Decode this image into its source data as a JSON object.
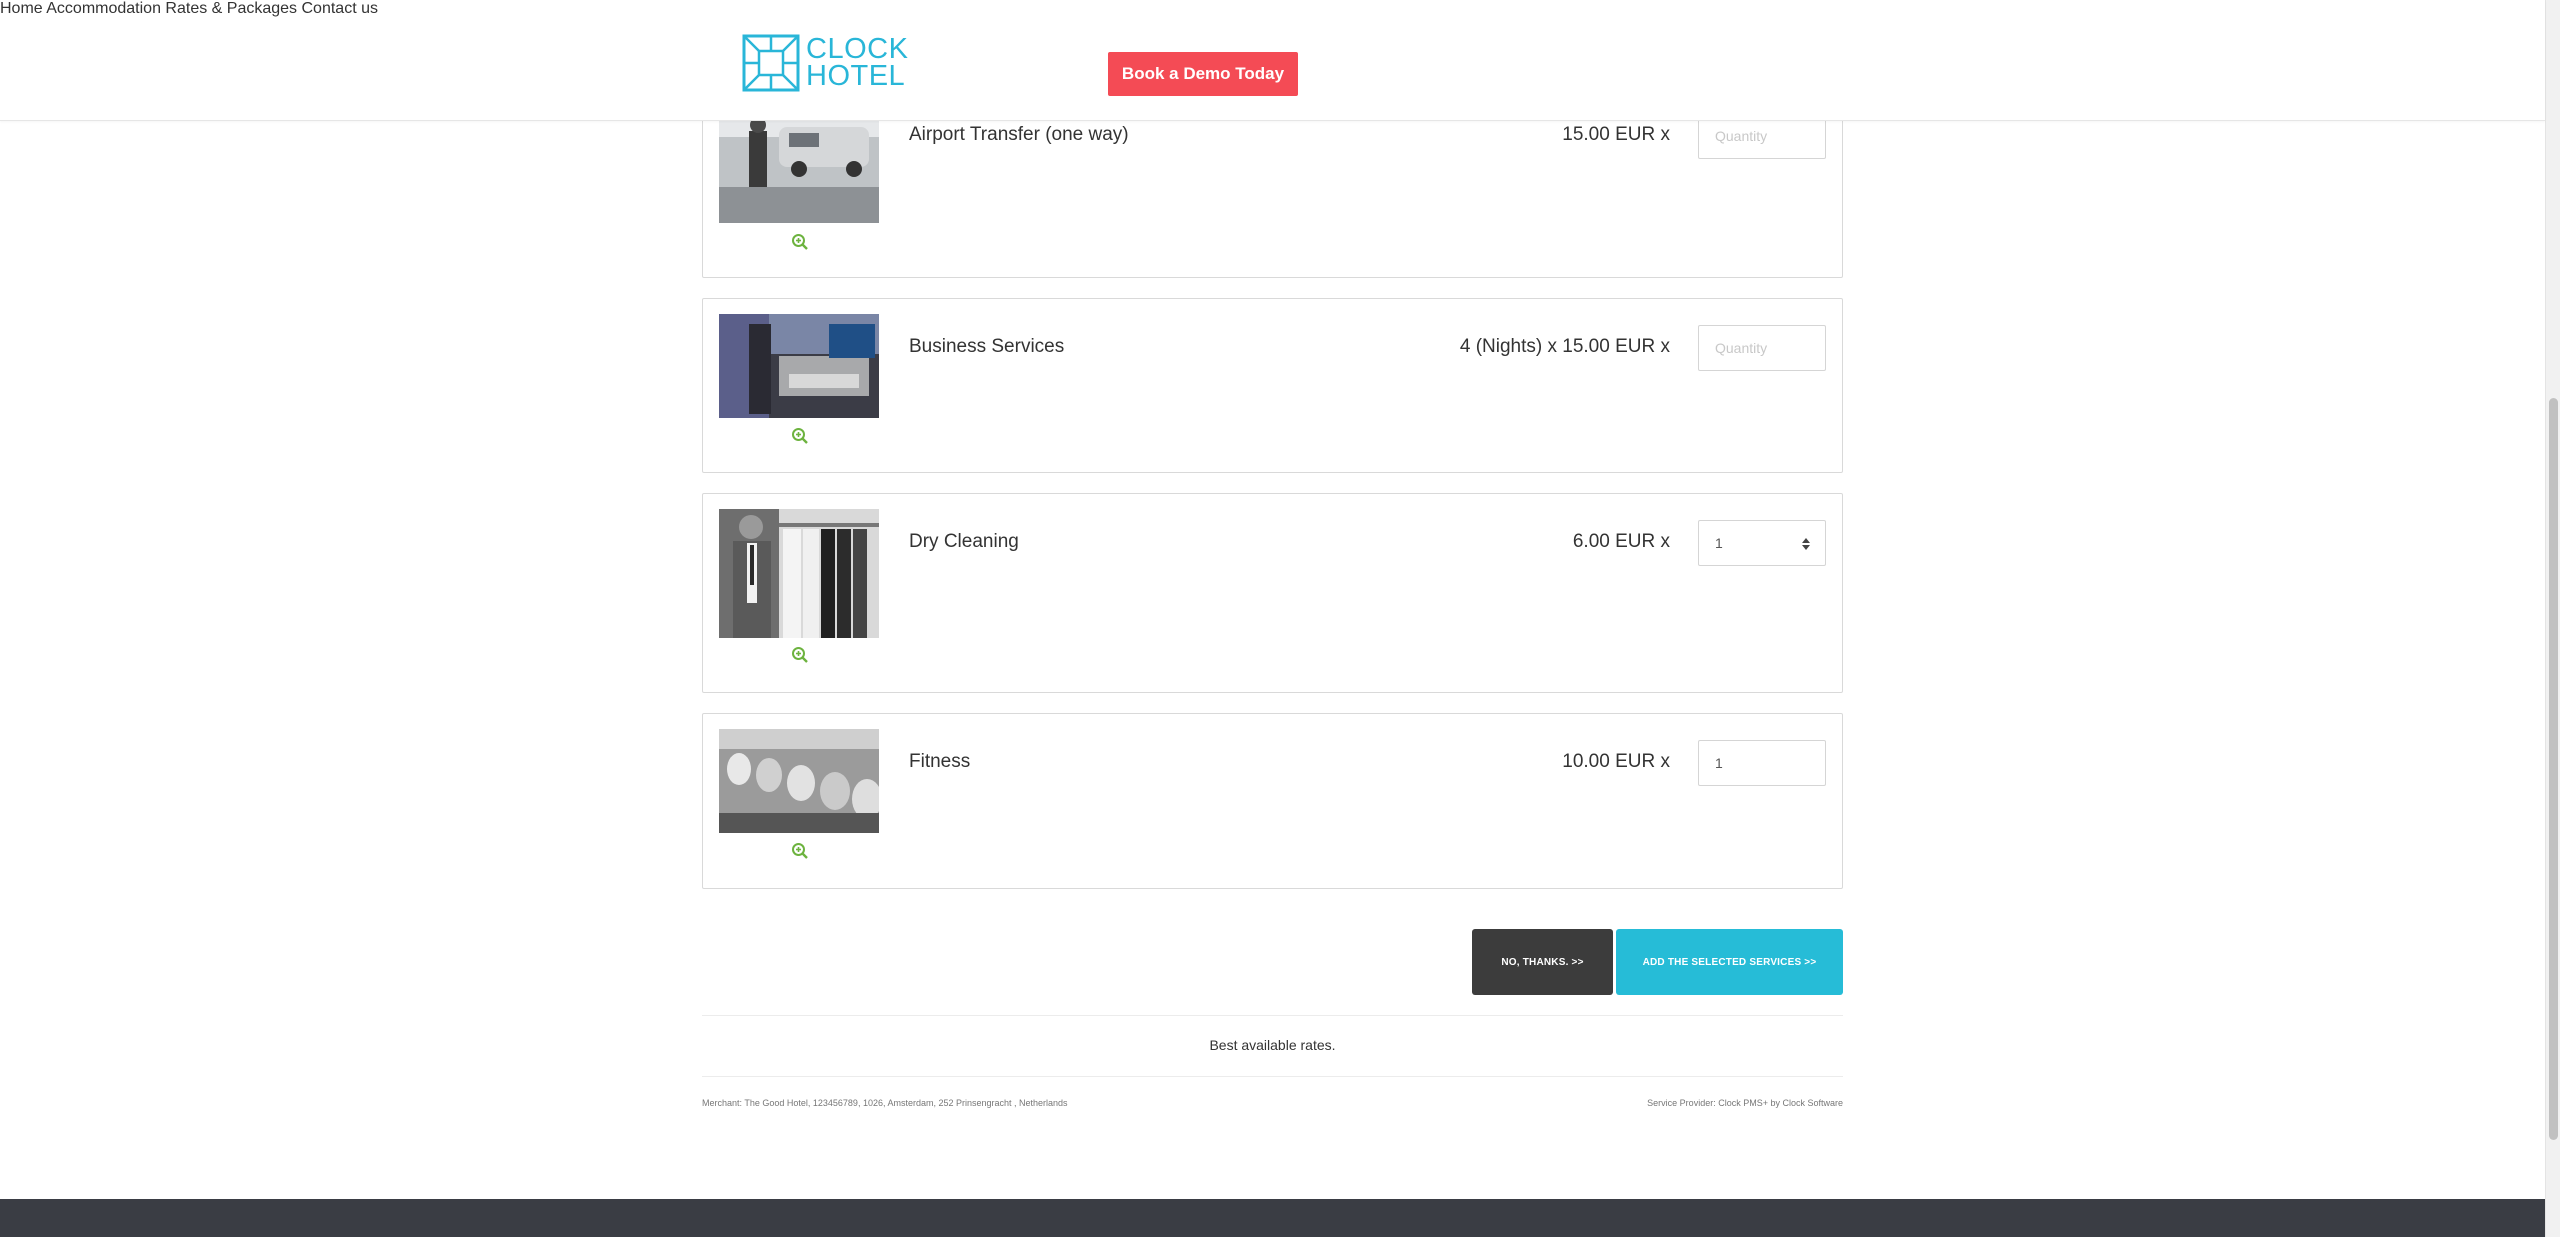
{
  "brand": {
    "logo_line1": "CLOCK",
    "logo_line2": "HOTEL",
    "color": "#29b6d8"
  },
  "header": {
    "demo_button": "Book a Demo Today",
    "nav": [
      "Home",
      "Accommodation",
      "Rates & Packages",
      "Contact us"
    ]
  },
  "services": [
    {
      "name": "Airport Transfer (one way)",
      "price": "15.00 EUR x",
      "quantity": "",
      "placeholder": "Quantity",
      "image": "airport-transfer-photo"
    },
    {
      "name": "Business Services",
      "price": "4 (Nights) x 15.00 EUR x",
      "quantity": "",
      "placeholder": "Quantity",
      "image": "business-services-photo"
    },
    {
      "name": "Dry Cleaning",
      "price": "6.00 EUR x",
      "quantity": "1",
      "placeholder": "Quantity",
      "image": "dry-cleaning-photo"
    },
    {
      "name": "Fitness",
      "price": "10.00 EUR x",
      "quantity": "1",
      "placeholder": "Quantity",
      "image": "fitness-photo"
    }
  ],
  "actions": {
    "no_thanks": "NO, THANKS. >>",
    "add_services": "ADD THE SELECTED SERVICES >>"
  },
  "info": {
    "best_rates": "Best available rates.",
    "merchant": "Merchant: The Good Hotel, 123456789, 1026, Amsterdam, 252 Prinsengracht , Netherlands",
    "provider": "Service Provider: Clock PMS+ by Clock Software"
  },
  "colors": {
    "demo_red": "#f44b55",
    "add_blue": "#26bcd7",
    "no_dark": "#3c3c3c",
    "zoom_green": "#6db33f",
    "footer_bg": "#3a3d44"
  }
}
